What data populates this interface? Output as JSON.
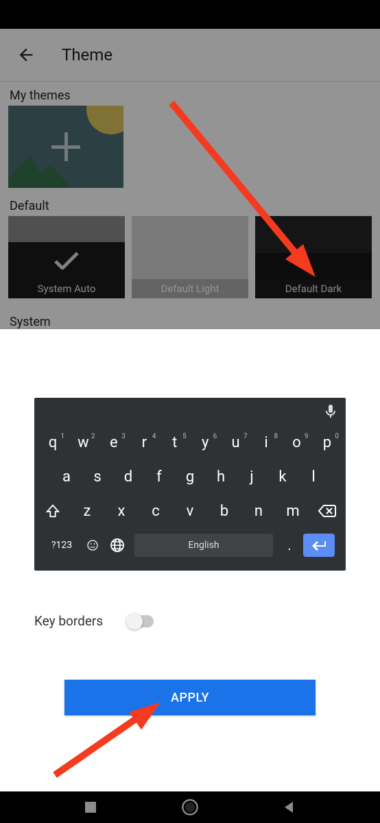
{
  "header": {
    "title": "Theme"
  },
  "sections": {
    "my_themes": "My themes",
    "default": "Default",
    "system": "System"
  },
  "themes": {
    "auto": "System Auto",
    "light": "Default Light",
    "dark": "Default Dark"
  },
  "keyboard": {
    "row1": [
      "q",
      "w",
      "e",
      "r",
      "t",
      "y",
      "u",
      "i",
      "o",
      "p"
    ],
    "nums": [
      "1",
      "2",
      "3",
      "4",
      "5",
      "6",
      "7",
      "8",
      "9",
      "0"
    ],
    "row2": [
      "a",
      "s",
      "d",
      "f",
      "g",
      "h",
      "j",
      "k",
      "l"
    ],
    "row3": [
      "z",
      "x",
      "c",
      "v",
      "b",
      "n",
      "m"
    ],
    "sym": "?123",
    "space": "English",
    "dot": "."
  },
  "option": {
    "key_borders": "Key borders"
  },
  "button": {
    "apply": "APPLY"
  }
}
